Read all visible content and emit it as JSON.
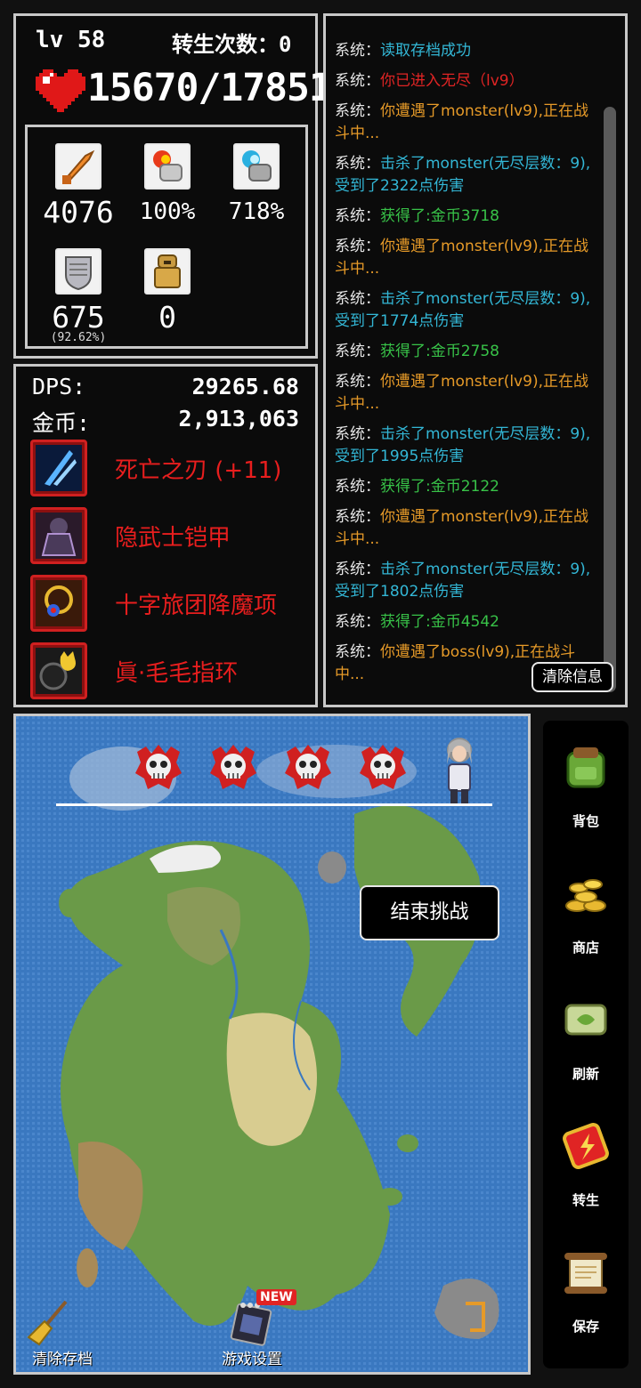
{
  "stats": {
    "level": "lv 58",
    "rebirth_label": "转生次数：0",
    "hp": "15670/17851",
    "attack": "4076",
    "crit_rate": "100%",
    "crit_damage": "718%",
    "defense": "675",
    "defense_percent": "(92.62%)",
    "special": "0"
  },
  "equipment": {
    "dps_label": "DPS:",
    "dps_value": "29265.68",
    "gold_label": "金币:",
    "gold_value": "2,913,063",
    "items": [
      {
        "name": "死亡之刃 (+11)"
      },
      {
        "name": "隐武士铠甲"
      },
      {
        "name": "十字旅团降魔项"
      },
      {
        "name": "眞·毛毛指环"
      }
    ]
  },
  "log": {
    "entries": [
      {
        "prefix": "系统：",
        "text": "读取存档成功",
        "color": "cyan"
      },
      {
        "prefix": "系统：",
        "text": "你已进入无尽（lv9）",
        "color": "red"
      },
      {
        "prefix": "系统：",
        "text": "你遭遇了monster(lv9),正在战斗中...",
        "color": "orange"
      },
      {
        "prefix": "系统：",
        "text": "击杀了monster(无尽层数：9),受到了2322点伤害",
        "color": "cyan"
      },
      {
        "prefix": "系统：",
        "text": "获得了:金币3718",
        "color": "green"
      },
      {
        "prefix": "系统：",
        "text": "你遭遇了monster(lv9),正在战斗中...",
        "color": "orange"
      },
      {
        "prefix": "系统：",
        "text": "击杀了monster(无尽层数：9),受到了1774点伤害",
        "color": "cyan"
      },
      {
        "prefix": "系统：",
        "text": "获得了:金币2758",
        "color": "green"
      },
      {
        "prefix": "系统：",
        "text": "你遭遇了monster(lv9),正在战斗中...",
        "color": "orange"
      },
      {
        "prefix": "系统：",
        "text": "击杀了monster(无尽层数：9),受到了1995点伤害",
        "color": "cyan"
      },
      {
        "prefix": "系统：",
        "text": "获得了:金币2122",
        "color": "green"
      },
      {
        "prefix": "系统：",
        "text": "你遭遇了monster(lv9),正在战斗中...",
        "color": "orange"
      },
      {
        "prefix": "系统：",
        "text": "击杀了monster(无尽层数：9),受到了1802点伤害",
        "color": "cyan"
      },
      {
        "prefix": "系统：",
        "text": "获得了:金币4542",
        "color": "green"
      },
      {
        "prefix": "系统：",
        "text": "你遭遇了boss(lv9),正在战斗中...",
        "color": "orange"
      }
    ],
    "clear_button": "清除信息"
  },
  "map": {
    "end_challenge_button": "结束挑战",
    "clear_save_label": "清除存档",
    "settings_label": "游戏设置",
    "new_badge": "NEW",
    "enemy_count": 4
  },
  "side_menu": {
    "items": [
      {
        "label": "背包",
        "icon": "backpack-icon"
      },
      {
        "label": "商店",
        "icon": "gold-coins-icon"
      },
      {
        "label": "刷新",
        "icon": "scroll-icon"
      },
      {
        "label": "转生",
        "icon": "rebirth-talisman-icon"
      },
      {
        "label": "保存",
        "icon": "save-scroll-icon"
      }
    ]
  },
  "colors": {
    "cyan": "#33b7d6",
    "red": "#e02424",
    "orange": "#e69a28",
    "green": "#38c248",
    "sea": "#3a78c0",
    "land": "#6a9a48"
  }
}
